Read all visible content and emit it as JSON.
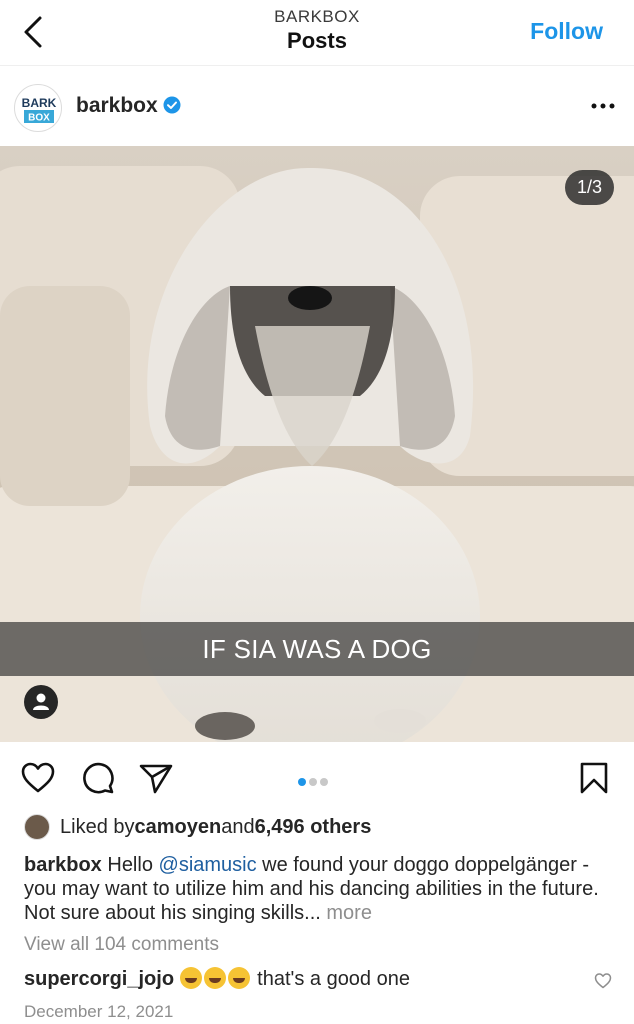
{
  "header": {
    "subtitle": "BARKBOX",
    "title": "Posts",
    "follow_label": "Follow"
  },
  "post": {
    "avatar_logo_top": "BARK",
    "avatar_logo_bottom": "BOX",
    "username": "barkbox",
    "image_counter": "1/3",
    "image_caption": "IF SIA WAS A DOG",
    "carousel_total": 3,
    "carousel_active": 1
  },
  "likes": {
    "prefix": "Liked by ",
    "liker": "camoyen",
    "middle": " and ",
    "others": "6,496 others"
  },
  "caption": {
    "username": "barkbox",
    "text_before": " Hello ",
    "mention": "@siamusic",
    "text_after": " we found your doggo doppelgänger - you may want to utilize him and his dancing abilities in the future. Not sure about his singing skills...",
    "more_label": "more"
  },
  "comments": {
    "view_all": "View all 104 comments",
    "items": [
      {
        "username": "supercorgi_jojo",
        "text": " that's a good one"
      }
    ]
  },
  "date": "December 12, 2021",
  "colors": {
    "accent": "#1d95e8",
    "text": "#262626",
    "muted": "#8e8e8e"
  },
  "icons": [
    "back-icon",
    "verified-icon",
    "more-icon",
    "user-tag-icon",
    "heart-icon",
    "comment-icon",
    "share-icon",
    "bookmark-icon"
  ]
}
